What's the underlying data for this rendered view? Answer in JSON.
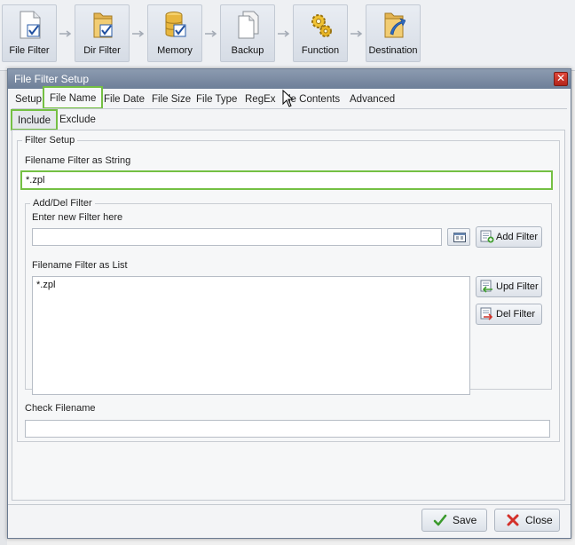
{
  "pipeline": {
    "steps": [
      {
        "label": "File Filter",
        "icon": "file-filter-icon"
      },
      {
        "label": "Dir Filter",
        "icon": "folder-check-icon"
      },
      {
        "label": "Memory",
        "icon": "database-check-icon"
      },
      {
        "label": "Backup",
        "icon": "documents-icon"
      },
      {
        "label": "Function",
        "icon": "gears-icon"
      },
      {
        "label": "Destination",
        "icon": "folder-arrow-icon"
      }
    ]
  },
  "dialog": {
    "title": "File Filter Setup",
    "close_glyph": "✕",
    "tabs": [
      "Setup",
      "File Name",
      "File Date",
      "File Size",
      "File Type",
      "RegEx",
      "File Contents",
      "Advanced"
    ],
    "contents_tab_visible": "le Contents",
    "active_tab": "File Name",
    "subtabs": [
      "Include",
      "Exclude"
    ],
    "active_subtab": "Include",
    "filter_setup": {
      "legend": "Filter Setup",
      "string_label": "Filename Filter as String",
      "string_value": "*.zpl",
      "add_del": {
        "legend": "Add/Del Filter",
        "new_label": "Enter new Filter here",
        "new_value": "",
        "add_button": "Add Filter",
        "list_label": "Filename Filter as List",
        "list_items": [
          "*.zpl"
        ],
        "upd_button": "Upd Filter",
        "del_button": "Del Filter"
      },
      "check_label": "Check Filename",
      "check_value": ""
    },
    "save_button": "Save",
    "close_button": "Close"
  },
  "colors": {
    "highlight": "#74c043",
    "titlebar": "#7b8aa2",
    "close_red": "#c9342a"
  }
}
